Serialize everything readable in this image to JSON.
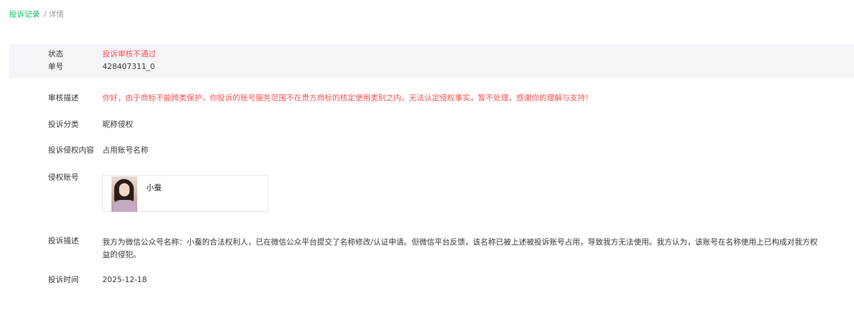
{
  "breadcrumb": {
    "parent": "投诉记录",
    "separator": "/",
    "current": "详情"
  },
  "status_panel": {
    "status_label": "状态",
    "status_value": "投诉审核不通过",
    "number_label": "单号",
    "number_value": "428407311_0"
  },
  "details": {
    "review_label": "审核描述",
    "review_value": "你好，由于商标不能跨类保护，你投诉的账号服务范围不在贵方商标的核定使用类别之内，无法认定侵权事实，暂不处理，感谢你的理解与支持！",
    "category_label": "投诉分类",
    "category_value": "昵称侵权",
    "content_label": "投诉侵权内容",
    "content_value": "占用账号名称",
    "account_label": "侵权账号",
    "account_name": "小蚕",
    "desc_label": "投诉描述",
    "desc_value": "我方为微信公众号名称：小蚕的合法权利人，已在微信公众平台提交了名称修改/认证申请。但微信平台反馈，该名称已被上述被投诉账号占用，导致我方无法使用。我方认为，该账号在名称使用上已构成对我方权益的侵犯。",
    "time_label": "投诉时间",
    "time_value": "2025-12-18"
  },
  "colors": {
    "accent_green": "#07c160",
    "status_red": "#fa5151",
    "panel_bg": "#f4f5f9"
  }
}
